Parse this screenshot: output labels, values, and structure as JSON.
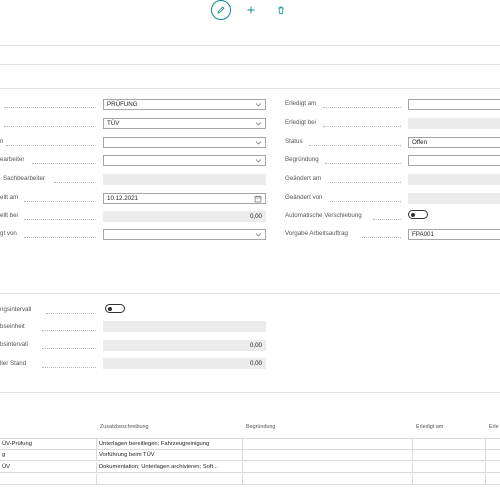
{
  "toolbar": {
    "edit_icon": "pencil-icon",
    "add_icon": "plus-icon",
    "delete_icon": "trash-icon",
    "accent_color": "#0b8a8a"
  },
  "left_fields": [
    {
      "label": "",
      "value": "PRÜFUNG",
      "kind": "dropdown"
    },
    {
      "label": "",
      "value": "TÜV",
      "kind": "dropdown"
    },
    {
      "label": "n",
      "value": "",
      "kind": "dropdown"
    },
    {
      "label": "earbeiter",
      "value": "",
      "kind": "dropdown"
    },
    {
      "label": "Sachbearbeiter",
      "value": "",
      "kind": "readonly"
    },
    {
      "label": "ellt am",
      "value": "10.12.2021",
      "kind": "date"
    },
    {
      "label": "ellt bei",
      "value": "0,00",
      "kind": "readonly"
    },
    {
      "label": "gt von",
      "value": "",
      "kind": "dropdown"
    }
  ],
  "right_fields": [
    {
      "label": "Erledigt am",
      "value": "",
      "kind": "input"
    },
    {
      "label": "Erledigt bei",
      "value": "",
      "kind": "readonly"
    },
    {
      "label": "Status",
      "value": "Offen",
      "kind": "input"
    },
    {
      "label": "Begründung",
      "value": "",
      "kind": "input"
    },
    {
      "label": "Geändert am",
      "value": "",
      "kind": "readonly"
    },
    {
      "label": "Geändert von",
      "value": "",
      "kind": "readonly"
    },
    {
      "label": "Automatische Verschiebung",
      "value": "",
      "kind": "toggle"
    },
    {
      "label": "Vorgabe Arbeitsauftrag",
      "value": "FPA001",
      "kind": "input"
    }
  ],
  "interval_fields": [
    {
      "label": "ngsintervall",
      "value": "",
      "kind": "toggle"
    },
    {
      "label": "bseinheit",
      "value": "",
      "kind": "readonly"
    },
    {
      "label": "bsintervall",
      "value": "0,00",
      "kind": "readonly"
    },
    {
      "label": "ller Stand",
      "value": "0,00",
      "kind": "readonly"
    }
  ],
  "grid": {
    "columns": [
      "",
      "Zusatzbeschreibung",
      "Begründung",
      "Erledigt am",
      "Erle"
    ],
    "rows": [
      [
        "ÜV-Prüfung",
        "Unterlagen bereitlegen; Fahrzeugreinigung",
        "",
        "",
        ""
      ],
      [
        "g",
        "Vorführung beim TÜV",
        "",
        "",
        ""
      ],
      [
        "ÜV",
        "Dokumentation; Unterlagen archivieren; Soft...",
        "",
        "",
        ""
      ],
      [
        "",
        "",
        "",
        "",
        ""
      ]
    ]
  }
}
